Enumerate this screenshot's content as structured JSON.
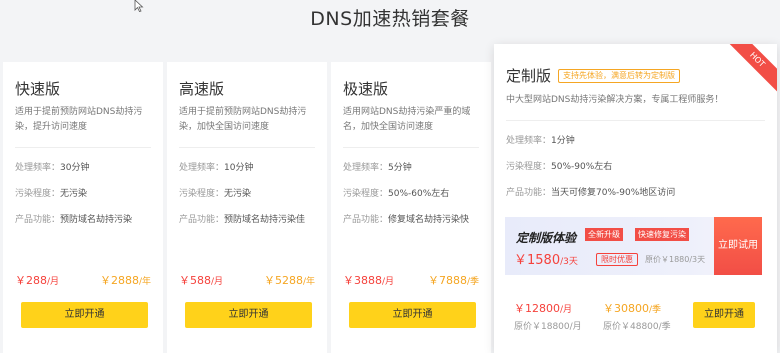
{
  "title": "DNS加速热销套餐",
  "plans": [
    {
      "name": "快速版",
      "desc": "适用于提前预防网站DNS劫持污染，提升访问速度",
      "specs": [
        {
          "k": "处理频率：",
          "v": "30分钟"
        },
        {
          "k": "污染程度：",
          "v": "无污染"
        },
        {
          "k": "产品功能：",
          "v": "预防域名劫持污染"
        }
      ],
      "price1": "￥288",
      "unit1": "/月",
      "price2": "￥2888",
      "unit2": "/年",
      "button": "立即开通"
    },
    {
      "name": "高速版",
      "desc": "适用于提前预防网站DNS劫持污染，加快全国访问速度",
      "specs": [
        {
          "k": "处理频率：",
          "v": "10分钟"
        },
        {
          "k": "污染程度：",
          "v": "无污染"
        },
        {
          "k": "产品功能：",
          "v": "预防域名劫持污染佳"
        }
      ],
      "price1": "￥588",
      "unit1": "/月",
      "price2": "￥5288",
      "unit2": "/年",
      "button": "立即开通"
    },
    {
      "name": "极速版",
      "desc": "适用网站DNS劫持污染严重的域名，加快全国访问速度",
      "specs": [
        {
          "k": "处理频率：",
          "v": "5分钟"
        },
        {
          "k": "污染程度：",
          "v": "50%-60%左右"
        },
        {
          "k": "产品功能：",
          "v": "修复域名劫持污染快"
        }
      ],
      "price1": "￥3888",
      "unit1": "/月",
      "price2": "￥7888",
      "unit2": "/季",
      "button": "立即开通"
    }
  ],
  "custom": {
    "name": "定制版",
    "tag": "支持先体验，满意后转为定制版",
    "ribbon": "HOT",
    "desc": "中大型网站DNS劫持污染解决方案，专属工程师服务！",
    "specs": [
      {
        "k": "处理频率：",
        "v": "1分钟"
      },
      {
        "k": "污染程度：",
        "v": "50%-90%左右"
      },
      {
        "k": "产品功能：",
        "v": "当天可修复70%-90%地区访问"
      }
    ],
    "promo": {
      "title": "定制版体验",
      "badge1": "全新升级",
      "badge2": "快速修复污染",
      "price": "￥1580",
      "unit": "/3天",
      "limited": "限时优惠",
      "orig": "原价￥1880/3天",
      "button": "立即试用"
    },
    "price1": "￥12800",
    "unit1": "/月",
    "orig1": "原价￥18800/月",
    "price2": "￥30800",
    "unit2": "/季",
    "orig2": "原价￥48800/季",
    "button": "立即开通"
  }
}
